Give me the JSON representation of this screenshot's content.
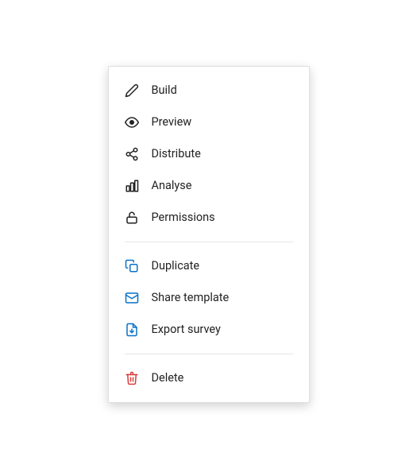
{
  "menu": {
    "items": [
      {
        "label": "Build"
      },
      {
        "label": "Preview"
      },
      {
        "label": "Distribute"
      },
      {
        "label": "Analyse"
      },
      {
        "label": "Permissions"
      },
      {
        "label": "Duplicate"
      },
      {
        "label": "Share template"
      },
      {
        "label": "Export survey"
      },
      {
        "label": "Delete"
      }
    ]
  }
}
